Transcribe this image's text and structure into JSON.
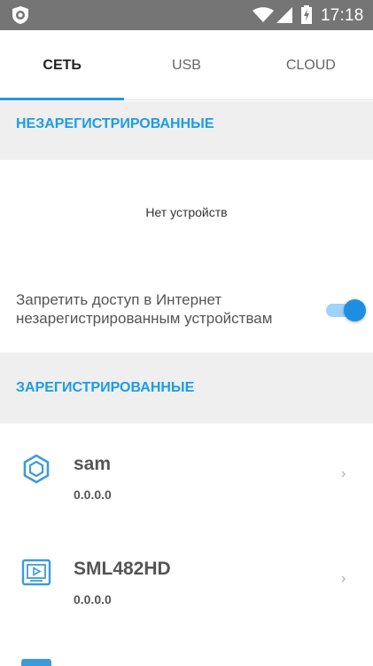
{
  "status_bar": {
    "time": "17:18",
    "icons": [
      "shield-app-icon",
      "wifi-icon",
      "signal-icon",
      "battery-charging-icon"
    ]
  },
  "tabs": [
    {
      "label": "СЕТЬ",
      "active": true
    },
    {
      "label": "USB",
      "active": false
    },
    {
      "label": "CLOUD",
      "active": false
    }
  ],
  "unregistered": {
    "header": "НЕЗАРЕГИСТРИРОВАННЫЕ",
    "empty_text": "Нет устройств",
    "block_label": "Запретить доступ в Интернет незарегистрированным устройствам",
    "block_enabled": true
  },
  "registered": {
    "header": "ЗАРЕГИСТРИРОВАННЫЕ",
    "devices": [
      {
        "name": "sam",
        "ip": "0.0.0.0",
        "icon": "hexagon-device-icon"
      },
      {
        "name": "SML482HD",
        "ip": "0.0.0.0",
        "icon": "tv-device-icon"
      }
    ]
  },
  "colors": {
    "accent": "#1e9be6",
    "status_bar": "#757575",
    "section_bg": "#efefef"
  }
}
